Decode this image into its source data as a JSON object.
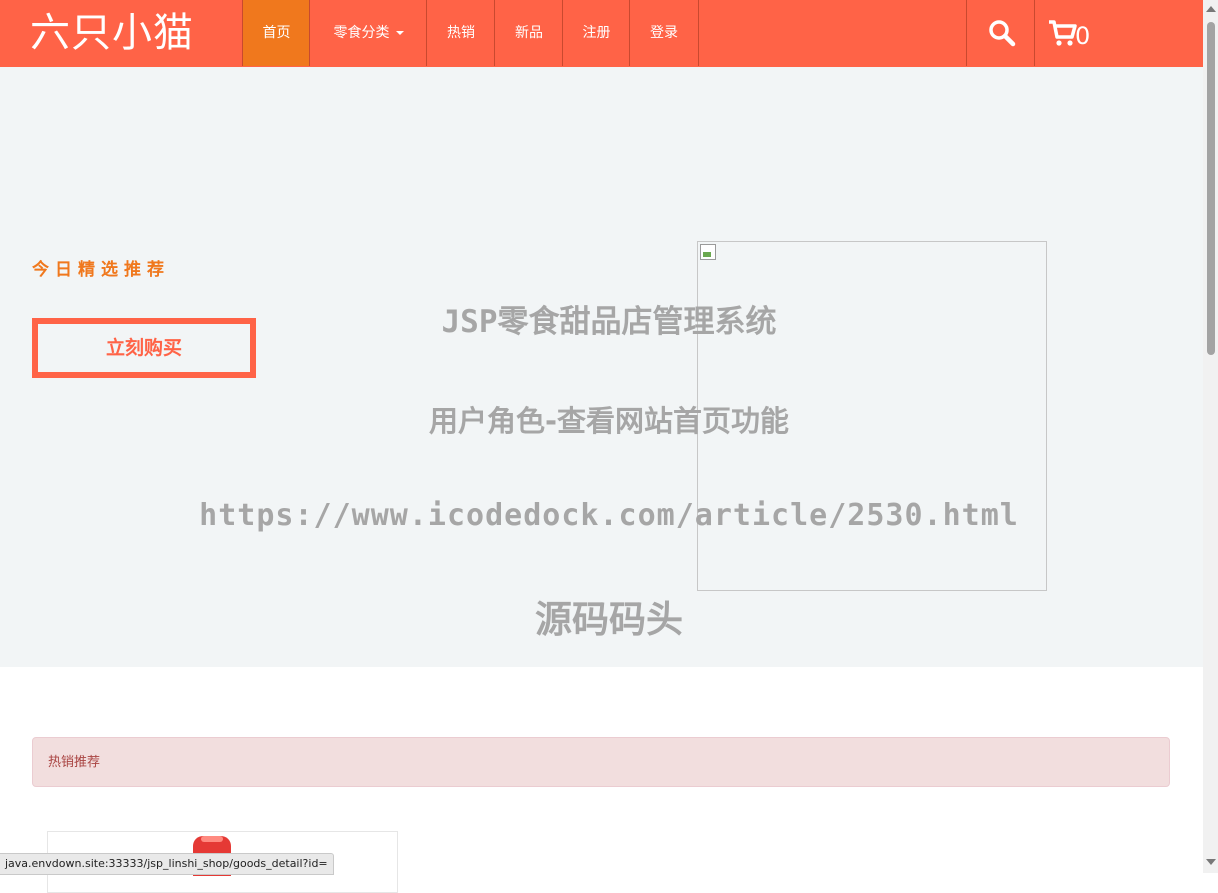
{
  "colors": {
    "primary": "#ff6347",
    "accent": "#f0781d",
    "hero_bg": "#f2f5f6",
    "alert_bg": "#f2dede",
    "alert_text": "#a94442"
  },
  "nav": {
    "brand": "六只小猫",
    "items": [
      {
        "label": "首页",
        "active": true
      },
      {
        "label": "零食分类",
        "dropdown": true
      },
      {
        "label": "热销"
      },
      {
        "label": "新品"
      },
      {
        "label": "注册"
      },
      {
        "label": "登录"
      }
    ],
    "search_icon": "search-icon",
    "cart_icon": "cart-icon",
    "cart_count": "0"
  },
  "hero": {
    "subtitle": "今日精选推荐",
    "buy_label": "立刻购买",
    "image_icon": "broken-image-icon"
  },
  "watermark": {
    "line1": "JSP零食甜品店管理系统",
    "line2": "用户角色-查看网站首页功能",
    "line3": "https://www.icodedock.com/article/2530.html",
    "line4": "源码码头"
  },
  "hot": {
    "title": "热销推荐"
  },
  "status_bar": {
    "url": "java.envdown.site:33333/jsp_linshi_shop/goods_detail?id="
  }
}
